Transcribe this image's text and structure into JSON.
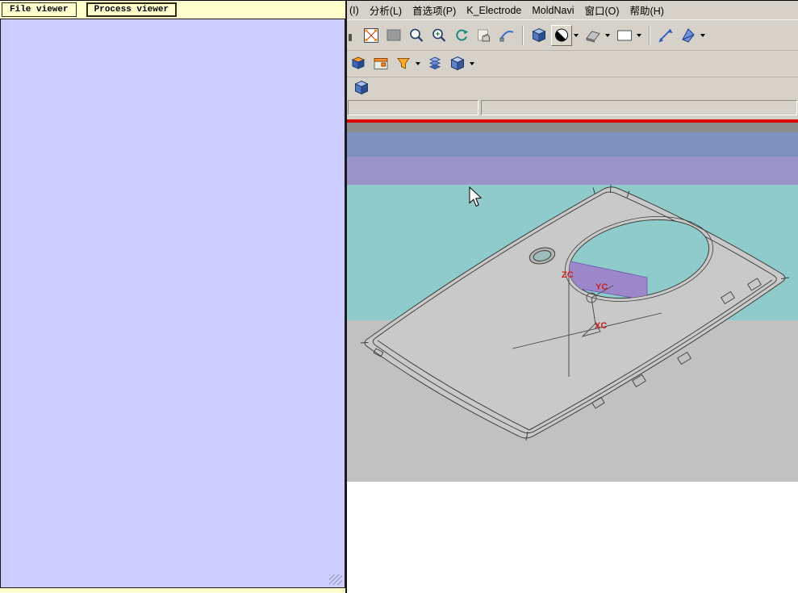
{
  "left_panel": {
    "tabs": [
      {
        "label": "File viewer",
        "active": false
      },
      {
        "label": "Process viewer",
        "active": true
      }
    ],
    "active_tab": "Process viewer"
  },
  "menu": {
    "items": [
      {
        "label": "(I)"
      },
      {
        "label": "分析(L)"
      },
      {
        "label": "首选项(P)"
      },
      {
        "label": "K_Electrode"
      },
      {
        "label": "MoldNavi"
      },
      {
        "label": "窗口(O)"
      },
      {
        "label": "帮助(H)"
      }
    ]
  },
  "toolbars": {
    "row1_icons": [
      "toolbar-overflow-icon",
      "snap-point-icon",
      "gray-swatch-icon",
      "zoom-icon",
      "zoom-in-icon",
      "regenerate-icon",
      "pan-icon",
      "fit-view-icon",
      "shaded-view-icon",
      "render-style-icon",
      "flat-plane-icon",
      "background-icon",
      "rotate-view-icon",
      "orient-view-icon"
    ],
    "row2_icons": [
      "mold-tool-icon",
      "dialog-icon",
      "filter-icon",
      "layers-icon",
      "assembly-icon"
    ],
    "row3_icons": [
      "part-cube-icon"
    ]
  },
  "viewport": {
    "axis_labels": [
      {
        "text": "ZC"
      },
      {
        "text": "YC"
      },
      {
        "text": "XC"
      }
    ],
    "background_bands": {
      "blue": "#7e92c0",
      "purple": "#9a94cb",
      "teal": "#8fcbca",
      "gray": "#c1c1c1",
      "white": "#ffffff"
    }
  },
  "colors": {
    "panel_body": "#ccccff",
    "tab_strip": "#ffffcc",
    "chrome": "#d6d2c9",
    "red_separator": "#dd0000",
    "dark_strip": "#8c8c8c",
    "part_fill": "#c9c9c9",
    "part_line": "#3f3f3f",
    "axis_label_color": "#cc2222"
  }
}
